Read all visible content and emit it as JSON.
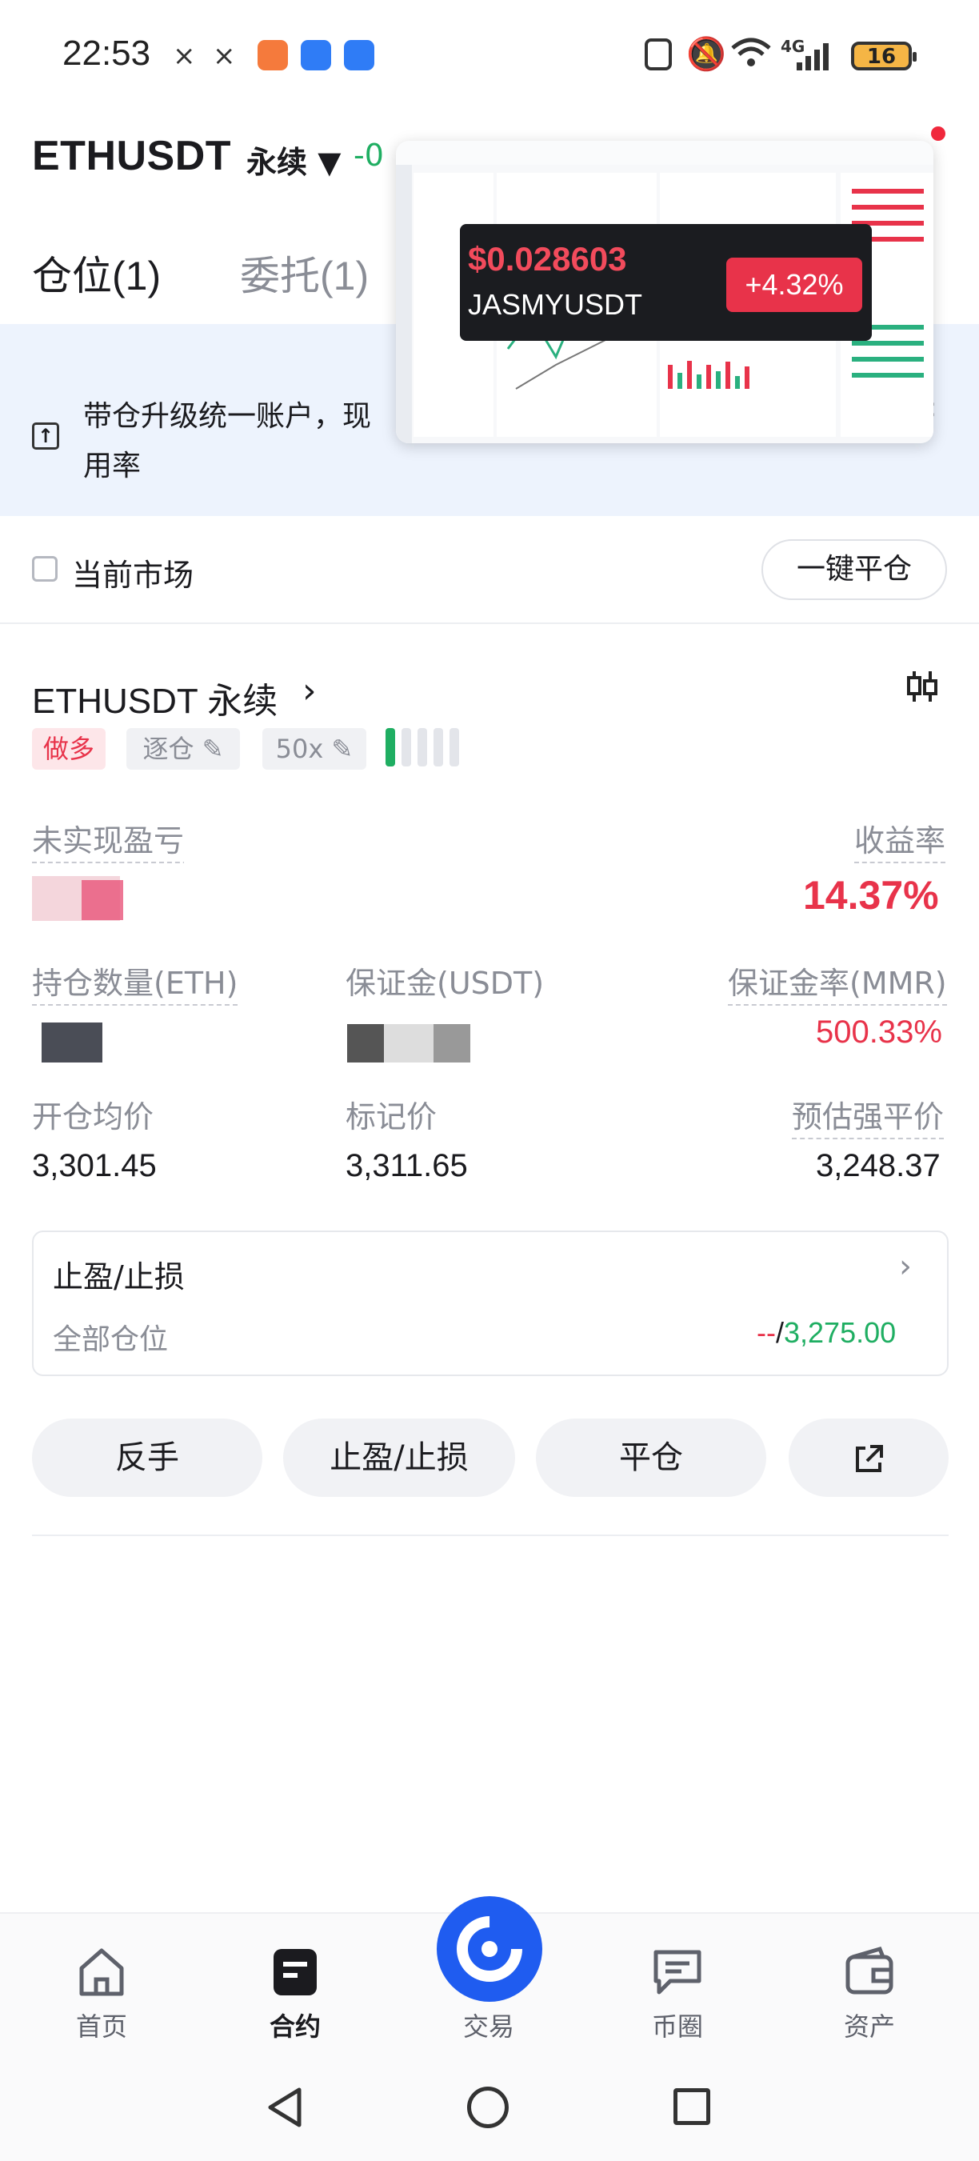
{
  "status_bar": {
    "time": "22:53",
    "battery": "16",
    "network": "4G",
    "colors": {
      "orange_app": "#f57a3c",
      "blue_app": "#2f7cf6"
    }
  },
  "header": {
    "symbol": "ETHUSDT",
    "contract_type": "永续 ▼",
    "change": "-0"
  },
  "tabs": [
    {
      "label": "仓位(1)",
      "active": true
    },
    {
      "label": "委托(1)",
      "active": false
    }
  ],
  "banner": {
    "text": "带仓升级统一账户，现",
    "text2": "用率",
    "icon": "upgrade-icon"
  },
  "overlay": {
    "price": "$0.028603",
    "symbol": "JASMYUSDT",
    "change": "+4.32%"
  },
  "filter": {
    "current_market_label": "当前市场",
    "close_all_label": "一键平仓"
  },
  "position": {
    "title": "ETHUSDT 永续",
    "tags": {
      "direction": "做多",
      "margin_mode": "逐仓",
      "leverage": "50x"
    },
    "unrealized_pnl_label": "未实现盈亏(USDT)",
    "roe_label": "收益率",
    "roe_value": "14.37%",
    "size_label": "持仓数量(ETH)",
    "margin_label": "保证金(USDT)",
    "mmr_label": "保证金率(MMR)",
    "mmr_value": "500.33%",
    "entry_label": "开仓均价",
    "entry_value": "3,301.45",
    "mark_label": "标记价",
    "mark_value": "3,311.65",
    "liq_label": "预估强平价",
    "liq_value": "3,248.37",
    "adl_level": 1
  },
  "tpsl": {
    "title": "止盈/止损",
    "scope": "全部仓位",
    "tp": "--",
    "separator": "/",
    "sl": "3,275.00"
  },
  "actions": {
    "reverse": "反手",
    "tpsl": "止盈/止损",
    "close": "平仓"
  },
  "nav": [
    {
      "label": "首页",
      "icon": "home-icon"
    },
    {
      "label": "合约",
      "icon": "futures-icon"
    },
    {
      "label": "交易",
      "icon": "trade-icon"
    },
    {
      "label": "币圈",
      "icon": "community-icon"
    },
    {
      "label": "资产",
      "icon": "wallet-icon"
    }
  ]
}
